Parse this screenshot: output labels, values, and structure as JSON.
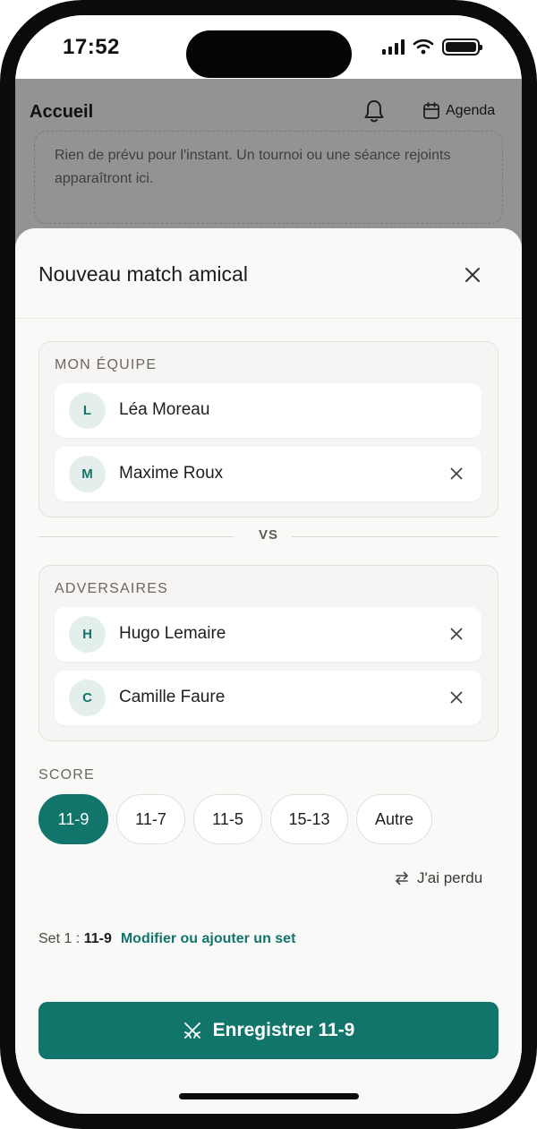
{
  "status_bar": {
    "time": "17:52"
  },
  "app": {
    "title": "Accueil",
    "agenda_label": "Agenda",
    "empty_message": "Rien de prévu pour l'instant. Un tournoi ou une séance rejoints apparaîtront ici."
  },
  "sheet": {
    "title": "Nouveau match amical",
    "my_team": {
      "label": "MON ÉQUIPE",
      "players": [
        {
          "initial": "L",
          "name": "Léa Moreau",
          "removable": false
        },
        {
          "initial": "M",
          "name": "Maxime Roux",
          "removable": true
        }
      ]
    },
    "vs_label": "VS",
    "opponents": {
      "label": "ADVERSAIRES",
      "players": [
        {
          "initial": "H",
          "name": "Hugo Lemaire",
          "removable": true
        },
        {
          "initial": "C",
          "name": "Camille Faure",
          "removable": true
        }
      ]
    },
    "score": {
      "label": "SCORE",
      "options": [
        "11-9",
        "11-7",
        "11-5",
        "15-13",
        "Autre"
      ],
      "selected": "11-9"
    },
    "lost_label": "J'ai perdu",
    "set_summary": {
      "prefix": "Set 1 :",
      "score": "11-9",
      "link": "Modifier ou ajouter un set"
    },
    "save_label": "Enregistrer 11-9"
  },
  "colors": {
    "accent": "#12756c",
    "avatar_bg": "#e4efec"
  }
}
